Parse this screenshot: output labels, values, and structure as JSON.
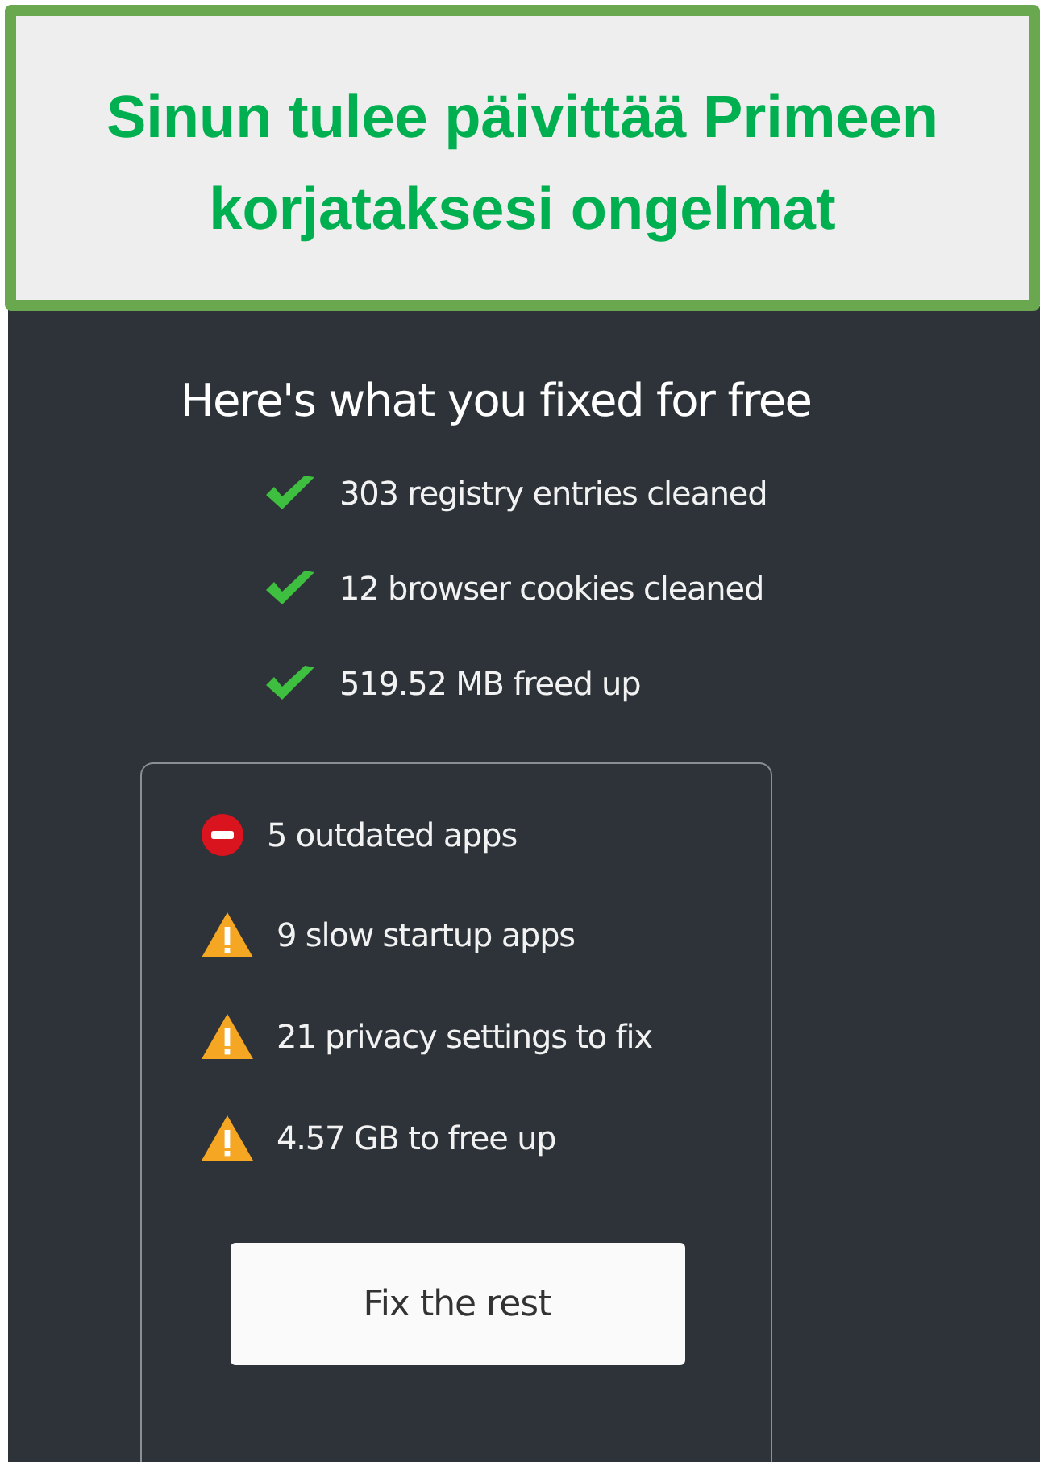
{
  "banner": {
    "title": "Sinun tulee päivittää Primeen korjataksesi ongelmat"
  },
  "summary": {
    "heading": "Here's what you fixed for free",
    "fixed": [
      {
        "label": "303 registry entries cleaned"
      },
      {
        "label": "12 browser cookies cleaned"
      },
      {
        "label": "519.52 MB freed up"
      }
    ],
    "issues": [
      {
        "kind": "error",
        "label": "5 outdated apps"
      },
      {
        "kind": "warning",
        "label": "9 slow startup apps"
      },
      {
        "kind": "warning",
        "label": "21 privacy settings to fix"
      },
      {
        "kind": "warning",
        "label": "4.57 GB to free up"
      }
    ],
    "button": "Fix the rest"
  }
}
